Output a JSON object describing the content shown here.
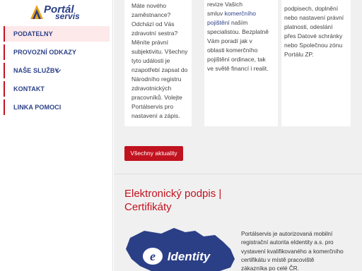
{
  "logo": {
    "line1": "Portál",
    "line2": "servis"
  },
  "nav": {
    "items": [
      {
        "label": "PODATELNY"
      },
      {
        "label": "PROVOZNÍ ODKAZY"
      },
      {
        "label": "NAŠE SLUŽBY"
      },
      {
        "label": "KONTAKT"
      },
      {
        "label": "LINKA POMOCI"
      }
    ]
  },
  "cards": [
    {
      "lines": [
        "Máte nového",
        "zaměstnance?",
        "Odchází od Vás",
        "zdravotní sestra?",
        "Měníte právní",
        "subjektivitu. Všechny",
        "tyto události je",
        "nzapotřebí zapsat do",
        "Národního registru",
        "zdravotnických",
        "pracovníků. Volejte",
        "Portálservis pro",
        "nastavení a zápis."
      ]
    },
    {
      "line1": "revize Vašich",
      "line2_prefix": "smluv ",
      "line2_link": "komerčního",
      "line3_link": "pojištění",
      "line3_suffix": " naším",
      "lines_rest": [
        "specialistou. Bezplatně",
        "Vám poradí jak v",
        "oblasti komerčního",
        "pojištění ordinace, tak",
        "ve světě financí i realit."
      ]
    },
    {
      "lines": [
        "podpisech, doplnění",
        "nebo nastavení právní",
        "platnosti, odeslání",
        "přes Datové schránky",
        "nebo Společnou zónu",
        "Portálu ZP."
      ]
    }
  ],
  "button": {
    "label": "Všechny aktuality"
  },
  "section": {
    "title_line1": "Elektronický podpis |",
    "title_line2": "Certifikáty",
    "map_label": "eIdentity",
    "text_lines": [
      "Portálservis je autorizovaná mobilní",
      "registrační autorita eIdentity a.s. pro",
      "vystavení kvalifikovaného a komerčního",
      "certifikátu v místě pracoviště",
      "zákazníka po celé ČR."
    ]
  },
  "colors": {
    "accent": "#c1121f",
    "brand": "#2b3f87",
    "map": "#2b3f87"
  }
}
